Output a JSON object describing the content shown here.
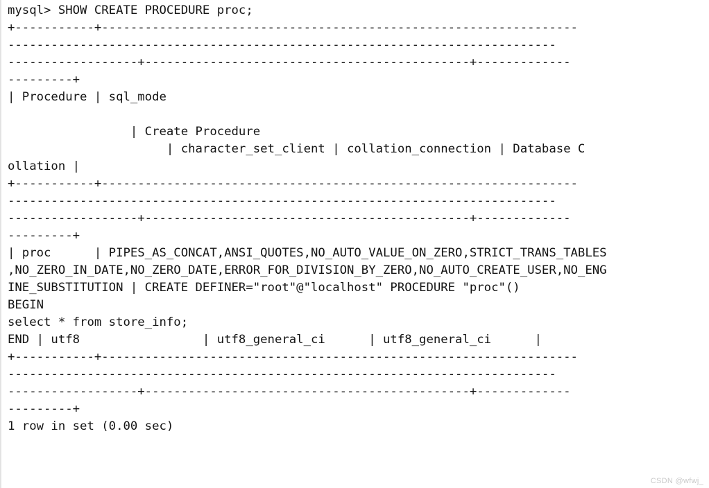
{
  "terminal": {
    "prompt_line": "mysql> SHOW CREATE PROCEDURE proc;",
    "lines": [
      "mysql> SHOW CREATE PROCEDURE proc;",
      "+-----------+------------------------------------------------------------------",
      "----------------------------------------------------------------------------",
      "------------------+---------------------------------------------+-------------",
      "---------+",
      "| Procedure | sql_mode",
      "",
      "                 | Create Procedure",
      "                      | character_set_client | collation_connection | Database C",
      "ollation |",
      "+-----------+------------------------------------------------------------------",
      "----------------------------------------------------------------------------",
      "------------------+---------------------------------------------+-------------",
      "---------+",
      "| proc      | PIPES_AS_CONCAT,ANSI_QUOTES,NO_AUTO_VALUE_ON_ZERO,STRICT_TRANS_TABLES",
      ",NO_ZERO_IN_DATE,NO_ZERO_DATE,ERROR_FOR_DIVISION_BY_ZERO,NO_AUTO_CREATE_USER,NO_ENG",
      "INE_SUBSTITUTION | CREATE DEFINER=\"root\"@\"localhost\" PROCEDURE \"proc\"()",
      "BEGIN",
      "select * from store_info;",
      "END | utf8                 | utf8_general_ci      | utf8_general_ci      |",
      "+-----------+------------------------------------------------------------------",
      "----------------------------------------------------------------------------",
      "------------------+---------------------------------------------+-------------",
      "---------+",
      "1 row in set (0.00 sec)"
    ],
    "command": "SHOW CREATE PROCEDURE proc;",
    "result_table": {
      "columns": [
        "Procedure",
        "sql_mode",
        "Create Procedure",
        "character_set_client",
        "collation_connection",
        "Database Collation"
      ],
      "rows": [
        {
          "Procedure": "proc",
          "sql_mode": "PIPES_AS_CONCAT,ANSI_QUOTES,NO_AUTO_VALUE_ON_ZERO,STRICT_TRANS_TABLES,NO_ZERO_IN_DATE,NO_ZERO_DATE,ERROR_FOR_DIVISION_BY_ZERO,NO_AUTO_CREATE_USER,NO_ENGINE_SUBSTITUTION",
          "Create Procedure": "CREATE DEFINER=\"root\"@\"localhost\" PROCEDURE \"proc\"()\nBEGIN\nselect * from store_info;\nEND",
          "character_set_client": "utf8",
          "collation_connection": "utf8_general_ci",
          "Database Collation": "utf8_general_ci"
        }
      ]
    },
    "status_line": "1 row in set (0.00 sec)",
    "row_count": 1,
    "elapsed": "0.00 sec",
    "text_color": "#151515",
    "background_color": "#ffffff"
  },
  "watermark": {
    "text": "CSDN @wfwj_",
    "color": "#c9c9c9"
  }
}
